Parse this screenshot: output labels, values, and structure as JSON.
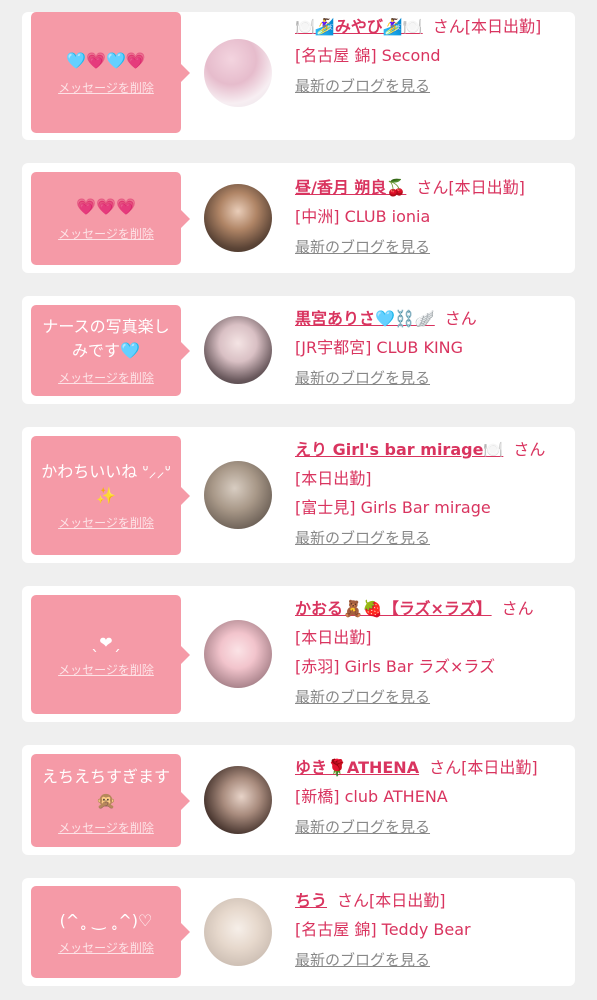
{
  "common": {
    "delete_label": "メッセージを削除",
    "blog_label": "最新のブログを見る",
    "san": "さん"
  },
  "colors": {
    "accent": "#d9345f",
    "bubble": "#f59aa7",
    "background": "#efefef"
  },
  "items": [
    {
      "message": "🩵💗🩵💗",
      "name": "🍽️🏄‍♀️みやび🏄‍♀️🍽️",
      "status": "[本日出勤]",
      "shop": "[名古屋 錦] Second"
    },
    {
      "message": "💗💗💗",
      "name": "昼/香月 朔良🍒",
      "status": "[本日出勤]",
      "shop": "[中洲] CLUB ionia"
    },
    {
      "message": "ナースの写真楽しみです🩵",
      "name": "黒宮ありさ🩵⛓️🪽",
      "status": "",
      "shop": "[JR宇都宮] CLUB KING"
    },
    {
      "message": "かわちいいね ᐡ⸝⸝ᐡ✨",
      "name": "えり Girl's bar mirage🍽️",
      "status": "[本日出勤]",
      "shop": "[富士見] Girls Bar mirage"
    },
    {
      "message": "ˎ❤︎ˏ",
      "name": "かおる🧸🍓【ラズ×ラズ】",
      "status": "[本日出勤]",
      "shop": "[赤羽] Girls Bar ラズ×ラズ"
    },
    {
      "message": "えちえちすぎます🙊",
      "name": "ゆき🌹ATHENA",
      "status": "[本日出勤]",
      "shop": "[新橋] club ATHENA"
    },
    {
      "message": "(^˳ ‿ ˳^)♡",
      "name": "ちう",
      "status": "[本日出勤]",
      "shop": "[名古屋 錦] Teddy Bear"
    }
  ]
}
